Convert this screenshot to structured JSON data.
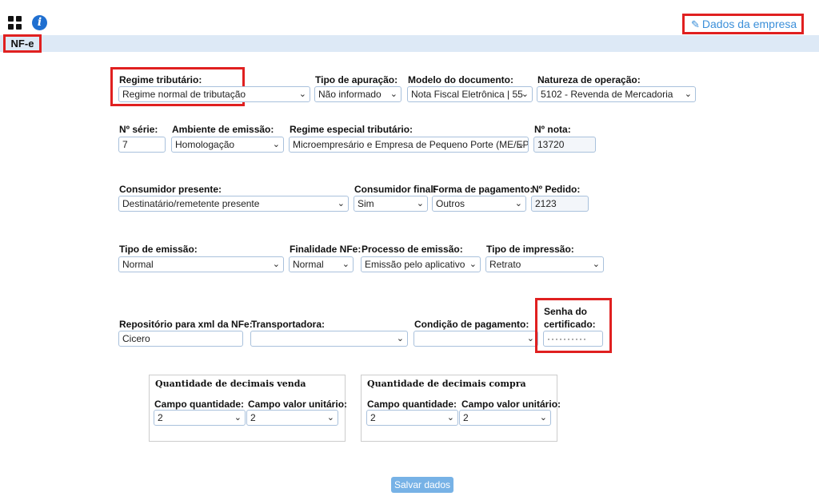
{
  "header": {
    "company_link": "Dados da empresa",
    "tab_label": "NF-e"
  },
  "form": {
    "regime_tributario": {
      "label": "Regime tributário:",
      "value": "Regime normal de tributação"
    },
    "tipo_apuracao": {
      "label": "Tipo de apuração:",
      "value": "Não informado"
    },
    "modelo_documento": {
      "label": "Modelo do documento:",
      "value": "Nota Fiscal Eletrônica | 55"
    },
    "natureza_operacao": {
      "label": "Natureza de operação:",
      "value": "5102 - Revenda de Mercadoria"
    },
    "numero_serie": {
      "label": "Nº série:",
      "value": "7"
    },
    "ambiente_emissao": {
      "label": "Ambiente de emissão:",
      "value": "Homologação"
    },
    "regime_especial": {
      "label": "Regime especial tributário:",
      "value": "Microempresário e Empresa de Pequeno Porte (ME/EPP)"
    },
    "numero_nota": {
      "label": "Nº nota:",
      "value": "13720"
    },
    "consumidor_presente": {
      "label": "Consumidor presente:",
      "value": "Destinatário/remetente presente"
    },
    "consumidor_final": {
      "label": "Consumidor final:",
      "value": "Sim"
    },
    "forma_pagamento": {
      "label": "Forma de pagamento:",
      "value": "Outros"
    },
    "numero_pedido": {
      "label": "Nº Pedido:",
      "value": "2123"
    },
    "tipo_emissao": {
      "label": "Tipo de emissão:",
      "value": "Normal"
    },
    "finalidade_nfe": {
      "label": "Finalidade NFe:",
      "value": "Normal"
    },
    "processo_emissao": {
      "label": "Processo de emissão:",
      "value": "Emissão pelo aplicativo"
    },
    "tipo_impressao": {
      "label": "Tipo de impressão:",
      "value": "Retrato"
    },
    "repositorio_xml": {
      "label": "Repositório para xml da NFe:",
      "value": "Cicero"
    },
    "transportadora": {
      "label": "Transportadora:",
      "value": ""
    },
    "condicao_pagamento": {
      "label": "Condição de pagamento:",
      "value": ""
    },
    "senha_certificado": {
      "label_line1": "Senha do",
      "label_line2": "certificado:",
      "value": "··········"
    }
  },
  "decimais_venda": {
    "title": "Quantidade de decimais venda",
    "campo_quantidade": {
      "label": "Campo quantidade:",
      "value": "2"
    },
    "campo_valor_unitario": {
      "label": "Campo valor unitário:",
      "value": "2"
    }
  },
  "decimais_compra": {
    "title": "Quantidade de decimais compra",
    "campo_quantidade": {
      "label": "Campo quantidade:",
      "value": "2"
    },
    "campo_valor_unitario": {
      "label": "Campo valor unitário:",
      "value": "2"
    }
  },
  "actions": {
    "save_label": "Salvar dados"
  },
  "colors": {
    "highlight": "#e02020",
    "link": "#3b8fd9",
    "band": "#dde9f6",
    "button": "#77b2e6",
    "info": "#1f6fd0"
  }
}
